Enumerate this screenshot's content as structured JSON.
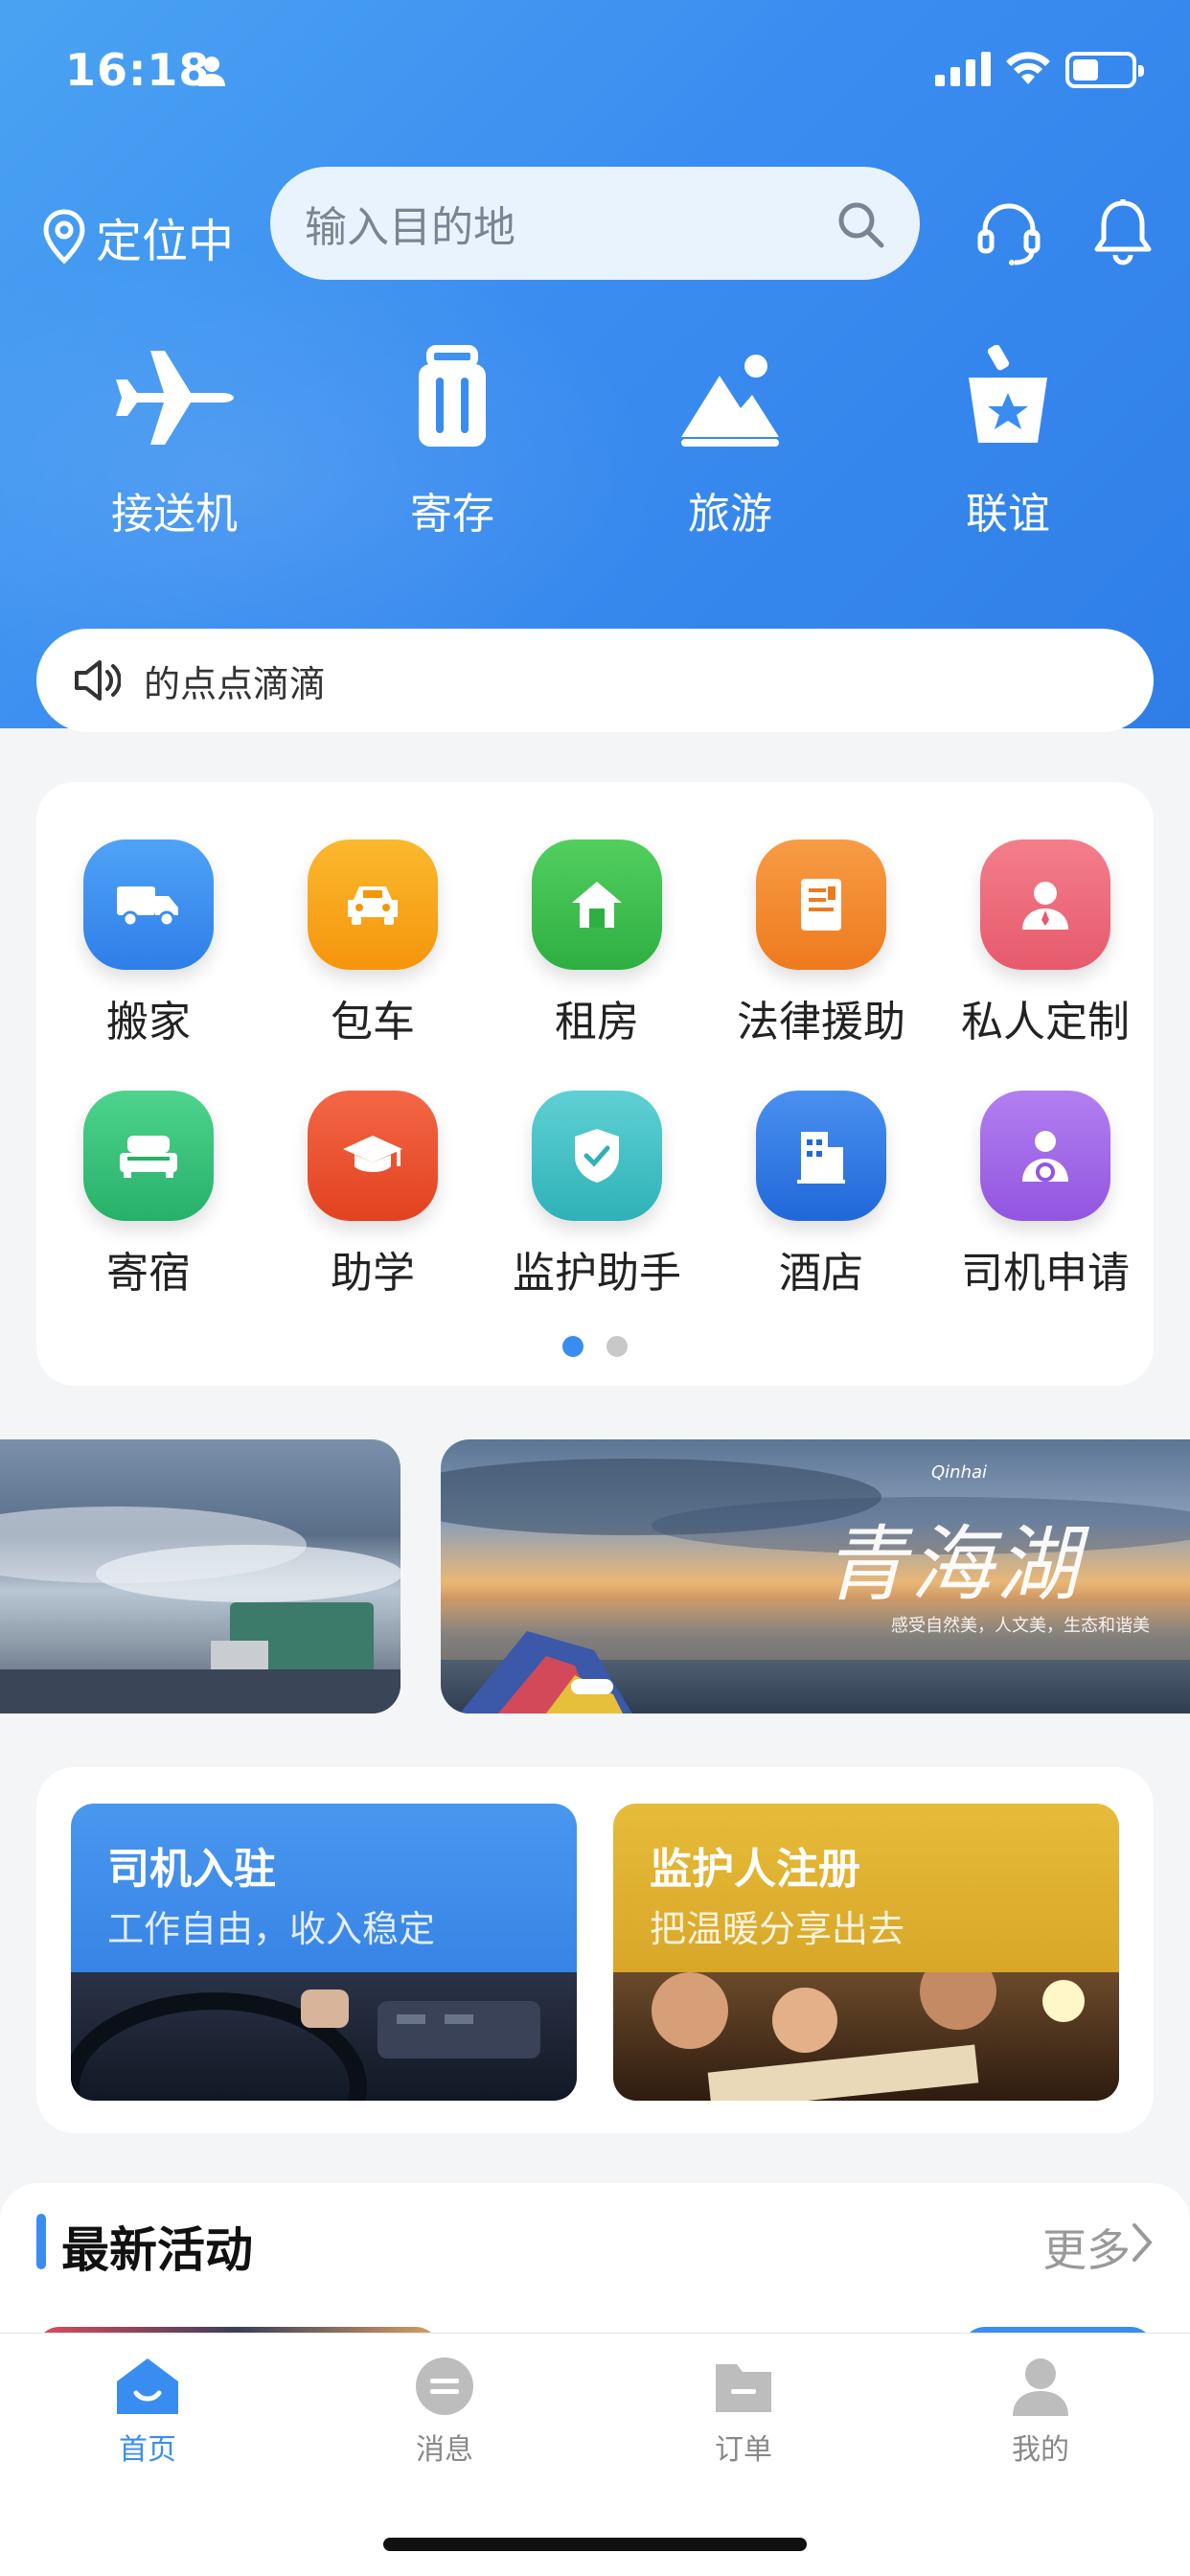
{
  "status_bar": {
    "time": "16:18"
  },
  "header": {
    "location_label": "定位中",
    "search_placeholder": "输入目的地"
  },
  "quick_actions": [
    {
      "label": "接送机",
      "icon": "airplane-icon"
    },
    {
      "label": "寄存",
      "icon": "luggage-icon"
    },
    {
      "label": "旅游",
      "icon": "mountain-icon"
    },
    {
      "label": "联谊",
      "icon": "party-icon"
    }
  ],
  "notice": {
    "text": "的点点滴滴"
  },
  "services": [
    {
      "label": "搬家",
      "icon": "truck-icon",
      "color": "#3a8df0"
    },
    {
      "label": "包车",
      "icon": "car-icon",
      "color": "#f7a21b"
    },
    {
      "label": "租房",
      "icon": "house-icon",
      "color": "#3bbf4f"
    },
    {
      "label": "法律援助",
      "icon": "document-icon",
      "color": "#f28a2c"
    },
    {
      "label": "私人定制",
      "icon": "person-icon",
      "color": "#ef6a7a"
    },
    {
      "label": "寄宿",
      "icon": "bed-icon",
      "color": "#33c07c"
    },
    {
      "label": "助学",
      "icon": "graduation-cap-icon",
      "color": "#ee5130"
    },
    {
      "label": "监护助手",
      "icon": "shield-check-icon",
      "color": "#3fc2c7"
    },
    {
      "label": "酒店",
      "icon": "building-icon",
      "color": "#2f78e4"
    },
    {
      "label": "司机申请",
      "icon": "driver-icon",
      "color": "#a86ae8"
    }
  ],
  "banners": [
    {
      "brand": "Qinhai",
      "calligraphy": "青海湖",
      "caption": "感受自然美，人文美，生态和谐美"
    }
  ],
  "promo_cards": [
    {
      "title": "司机入驻",
      "subtitle": "工作自由，收入稳定"
    },
    {
      "title": "监护人注册",
      "subtitle": "把温暖分享出去"
    }
  ],
  "activities": {
    "title": "最新活动",
    "more": "更多"
  },
  "tabbar": [
    {
      "label": "首页",
      "active": true
    },
    {
      "label": "消息",
      "active": false
    },
    {
      "label": "订单",
      "active": false
    },
    {
      "label": "我的",
      "active": false
    }
  ]
}
